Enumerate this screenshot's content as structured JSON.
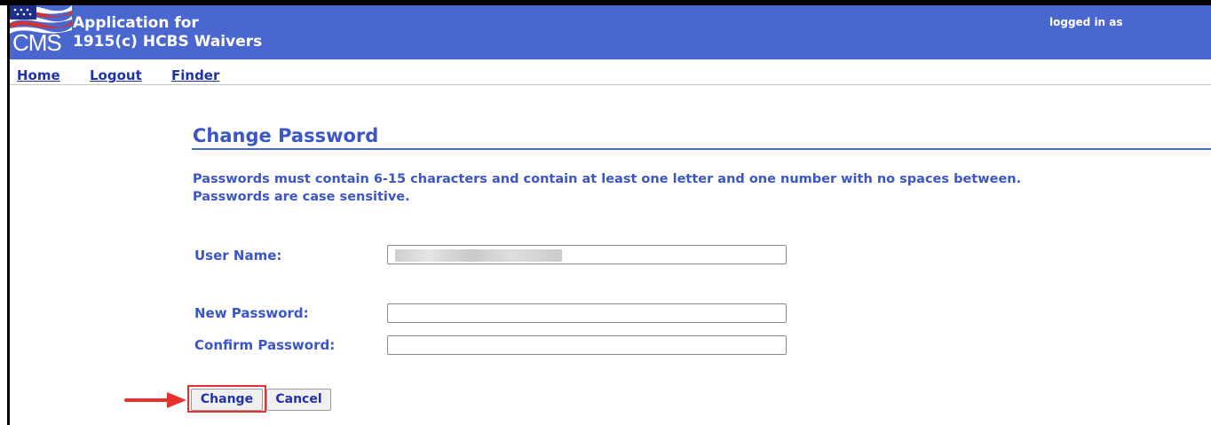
{
  "header": {
    "logo_text": "CMS",
    "title_line1": "Application for",
    "title_line2": "1915(c) HCBS Waivers",
    "logged_in_label": "logged in as",
    "color": "#4a67cf"
  },
  "nav": {
    "items": [
      "Home",
      "Logout",
      "Finder"
    ]
  },
  "page": {
    "title": "Change Password",
    "rule_line1": "Passwords must contain 6-15 characters and contain at least one letter and one number with no spaces between.",
    "rule_line2": "Passwords are case sensitive."
  },
  "form": {
    "user_name_label": "User Name:",
    "user_name_value": "",
    "new_password_label": "New Password:",
    "new_password_value": "",
    "confirm_password_label": "Confirm Password:",
    "confirm_password_value": ""
  },
  "buttons": {
    "change_label": "Change",
    "cancel_label": "Cancel"
  },
  "annotation": {
    "arrow_icon": "red-arrow-right-icon",
    "highlight_color": "#e8302d"
  }
}
